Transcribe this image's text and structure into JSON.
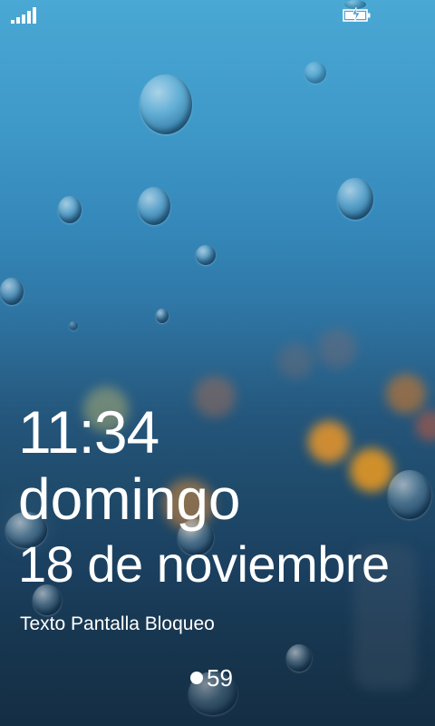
{
  "status_bar": {
    "signal_icon": "signal-strength-icon",
    "battery_icon": "battery-charging-icon"
  },
  "lock_screen": {
    "time": "11:34",
    "day": "domingo",
    "date": "18 de noviembre",
    "custom_text": "Texto Pantalla Bloqueo",
    "notification": {
      "icon": "notification-dot-icon",
      "count": "59"
    }
  },
  "colors": {
    "text": "#ffffff",
    "sky_top": "#4aa8d4",
    "sky_bottom": "#142e44"
  }
}
